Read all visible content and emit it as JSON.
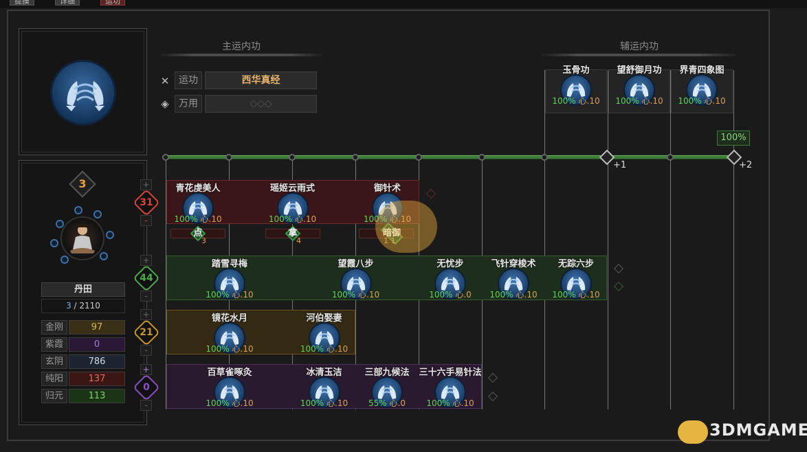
{
  "top_tabs": [
    "提摸",
    "详细",
    "运功"
  ],
  "main_section": {
    "title": "主运内功"
  },
  "aux_section": {
    "title": "辅运内功"
  },
  "slots": [
    {
      "label": "运功",
      "value": "西华真经"
    },
    {
      "label": "万用",
      "value": "◇◇◇"
    }
  ],
  "aux_skills": [
    {
      "name": "玉骨功",
      "pct": "100%",
      "xin": "心.10"
    },
    {
      "name": "望舒御月功",
      "pct": "100%",
      "xin": "心.10"
    },
    {
      "name": "界青四象图",
      "pct": "100%",
      "xin": "心.10"
    }
  ],
  "track": {
    "badge": "100%",
    "plus1": "+1",
    "plus2": "+2"
  },
  "character": {
    "level": "3",
    "dantian_label": "丹田",
    "dantian_current": "3",
    "dantian_max": "/ 2110",
    "stats": [
      {
        "name": "金刚",
        "value": "97",
        "color": "#d6b85a",
        "bg": "#3a3016"
      },
      {
        "name": "紫霞",
        "value": "0",
        "color": "#a77ad8",
        "bg": "#2a1836"
      },
      {
        "name": "玄阴",
        "value": "786",
        "color": "#cfd8e6",
        "bg": "#1b2430"
      },
      {
        "name": "纯阳",
        "value": "137",
        "color": "#e86a5a",
        "bg": "#3a1614"
      },
      {
        "name": "归元",
        "value": "113",
        "color": "#7fd46a",
        "bg": "#1b3416"
      }
    ]
  },
  "gems": [
    {
      "value": "31",
      "color": "#d6453a"
    },
    {
      "value": "44",
      "color": "#4fa84a"
    },
    {
      "value": "21",
      "color": "#c9952e"
    },
    {
      "value": "0",
      "color": "#8a4fc0"
    }
  ],
  "rows": [
    {
      "cards": [
        {
          "name": "青花虔美人",
          "pct": "100%",
          "xin": "心.10"
        },
        {
          "name": "瑶姬云雨式",
          "pct": "100%",
          "xin": "心.10"
        },
        {
          "name": "御针术",
          "pct": "100%",
          "xin": "心.10"
        }
      ]
    },
    {
      "cards": [
        {
          "name": "踏雪寻梅",
          "pct": "100%",
          "xin": "心.10"
        },
        {
          "name": "望霞八步",
          "pct": "100%",
          "xin": "心.10"
        },
        {
          "name": "无忧步",
          "pct": "100%",
          "xin": "心.0"
        },
        {
          "name": "飞针穿梭术",
          "pct": "100%",
          "xin": "心.10"
        },
        {
          "name": "无踪六步",
          "pct": "100%",
          "xin": "心.10"
        }
      ]
    },
    {
      "cards": [
        {
          "name": "镜花水月",
          "pct": "100%",
          "xin": "心.10"
        },
        {
          "name": "河伯娶妻",
          "pct": "100%",
          "xin": "心.10"
        }
      ]
    },
    {
      "cards": [
        {
          "name": "百草雀啄灸",
          "pct": "100%",
          "xin": "心.10"
        },
        {
          "name": "冰清玉洁",
          "pct": "100%",
          "xin": "心.10"
        },
        {
          "name": "三部九候法",
          "pct": "55%",
          "xin": "心.0"
        },
        {
          "name": "三十六手易针法",
          "pct": "100%",
          "xin": "心.10"
        }
      ]
    }
  ],
  "tags": [
    {
      "label": "点",
      "num": "3"
    },
    {
      "label": "拿",
      "num": "4"
    },
    {
      "label": "暗御",
      "num": "1 1"
    }
  ],
  "watermark": "3DMGAME"
}
